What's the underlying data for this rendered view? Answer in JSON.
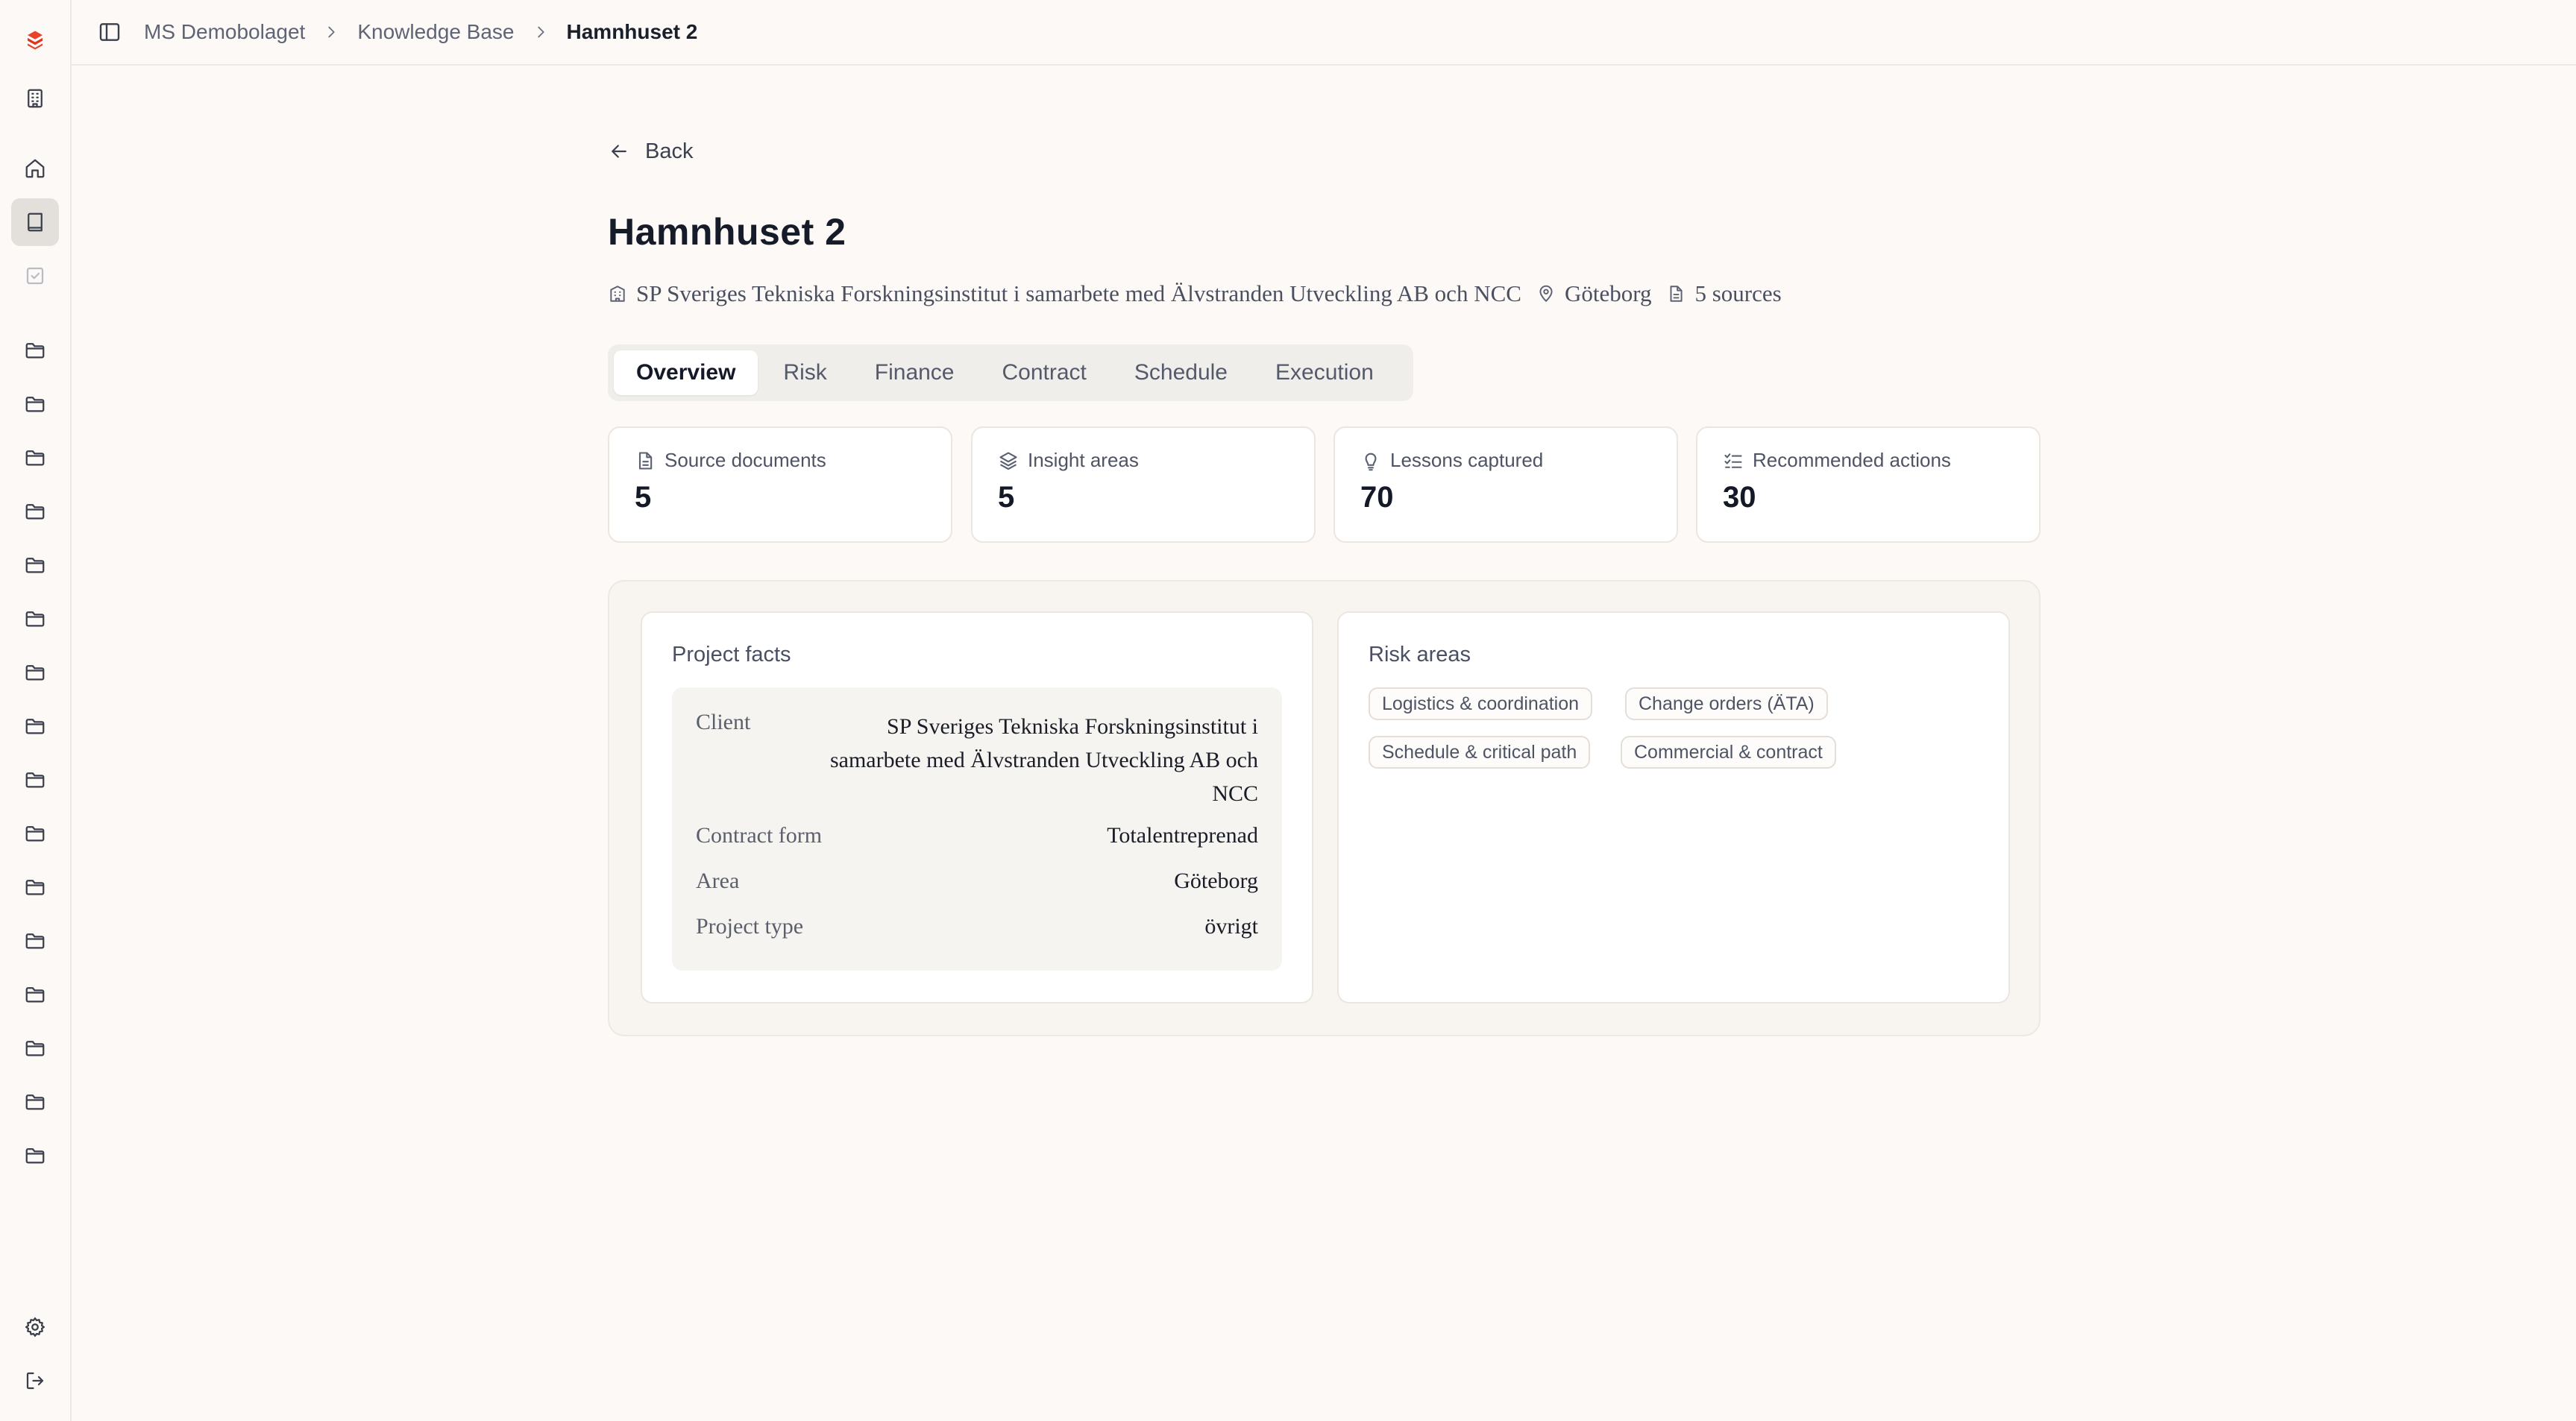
{
  "breadcrumb": {
    "items": [
      {
        "label": "MS Demobolaget"
      },
      {
        "label": "Knowledge Base"
      },
      {
        "label": "Hamnhuset 2"
      }
    ]
  },
  "rail": {
    "top_icons": [
      "logo-icon",
      "building-icon",
      "home-icon",
      "book-icon",
      "checkbox-icon"
    ],
    "folder_count_visible": 16,
    "bottom_icons": [
      "settings-icon",
      "logout-icon"
    ]
  },
  "back": {
    "label": "Back"
  },
  "project": {
    "title": "Hamnhuset 2",
    "client": "SP Sveriges Tekniska Forskningsinstitut i samarbete med Älvstranden Utveckling AB och NCC",
    "location": "Göteborg",
    "sources": "5 sources"
  },
  "tabs": [
    {
      "label": "Overview",
      "active": true
    },
    {
      "label": "Risk"
    },
    {
      "label": "Finance"
    },
    {
      "label": "Contract"
    },
    {
      "label": "Schedule"
    },
    {
      "label": "Execution"
    }
  ],
  "stats": [
    {
      "label": "Source documents",
      "value": "5",
      "icon": "document-icon"
    },
    {
      "label": "Insight areas",
      "value": "5",
      "icon": "layers-icon"
    },
    {
      "label": "Lessons captured",
      "value": "70",
      "icon": "lightbulb-icon"
    },
    {
      "label": "Recommended actions",
      "value": "30",
      "icon": "checklist-icon"
    }
  ],
  "project_facts": {
    "title": "Project facts",
    "rows": [
      {
        "key": "Client",
        "value": "SP Sveriges Tekniska Forskningsinstitut i samarbete med Älvstranden Utveckling AB och NCC"
      },
      {
        "key": "Contract form",
        "value": "Totalentreprenad"
      },
      {
        "key": "Area",
        "value": "Göteborg"
      },
      {
        "key": "Project type",
        "value": "övrigt"
      }
    ]
  },
  "risk_areas": {
    "title": "Risk areas",
    "chips": [
      "Logistics & coordination",
      "Change orders (ÄTA)",
      "Schedule & critical path",
      "Commercial & contract"
    ]
  },
  "colors": {
    "background": "#fdf9f6",
    "brand": "#e8412c",
    "text": "#1f2433"
  }
}
